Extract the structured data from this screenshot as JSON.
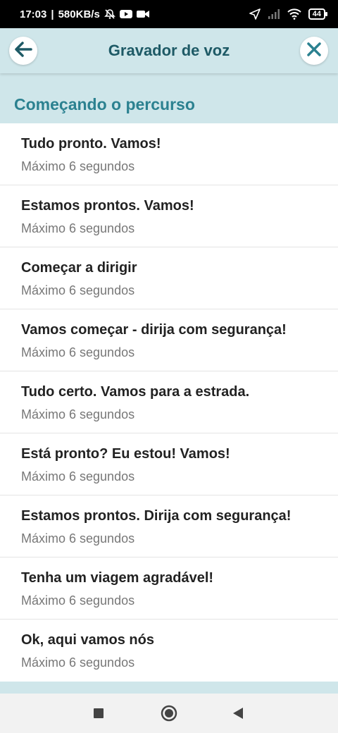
{
  "status_bar": {
    "time": "17:03",
    "speed": "580KB/s",
    "battery": "44",
    "icons": [
      "silent-alarm-icon",
      "youtube-icon",
      "video-camera-icon",
      "location-arrow-icon",
      "signal-icon",
      "wifi-icon",
      "battery-icon"
    ]
  },
  "header": {
    "title": "Gravador de voz",
    "back_icon": "arrow-left-icon",
    "close_icon": "close-icon",
    "accent_color": "#1e5a66"
  },
  "section": {
    "title": "Começando o percurso",
    "color": "#2b8190"
  },
  "items": [
    {
      "title": "Tudo pronto. Vamos!",
      "subtitle": "Máximo 6 segundos"
    },
    {
      "title": "Estamos prontos. Vamos!",
      "subtitle": "Máximo 6 segundos"
    },
    {
      "title": "Começar a dirigir",
      "subtitle": "Máximo 6 segundos"
    },
    {
      "title": "Vamos começar - dirija com segurança!",
      "subtitle": "Máximo 6 segundos"
    },
    {
      "title": "Tudo certo. Vamos para a estrada.",
      "subtitle": "Máximo 6 segundos"
    },
    {
      "title": "Está pronto? Eu estou! Vamos!",
      "subtitle": "Máximo 6 segundos"
    },
    {
      "title": "Estamos prontos. Dirija com segurança!",
      "subtitle": "Máximo 6 segundos"
    },
    {
      "title": "Tenha um viagem agradável!",
      "subtitle": "Máximo 6 segundos"
    },
    {
      "title": "Ok, aqui vamos nós",
      "subtitle": "Máximo 6 segundos"
    }
  ],
  "nav_bar": {
    "icons": [
      "recents-square-icon",
      "home-circle-icon",
      "back-triangle-icon"
    ]
  }
}
